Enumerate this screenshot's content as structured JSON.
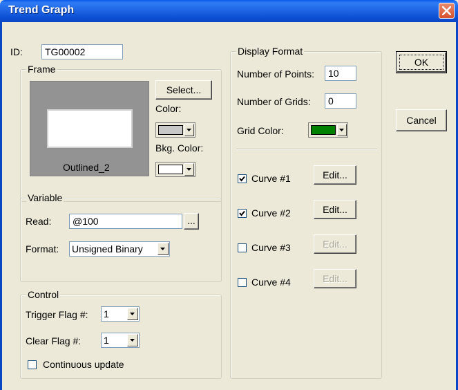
{
  "window": {
    "title": "Trend Graph",
    "close_label": "X"
  },
  "id_field": {
    "label": "ID:",
    "value": "TG00002"
  },
  "frame": {
    "legend": "Frame",
    "select_label": "Select...",
    "color_label": "Color:",
    "color": "#c8c8c8",
    "bkg_label": "Bkg. Color:",
    "bkg_color": "#ffffff",
    "preview_name": "Outlined_2"
  },
  "variable": {
    "legend": "Variable",
    "read_label": "Read:",
    "read_value": "@100",
    "browse_label": "...",
    "format_label": "Format:",
    "format_value": "Unsigned Binary"
  },
  "control": {
    "legend": "Control",
    "trigger_label": "Trigger Flag #:",
    "trigger_value": "1",
    "clear_label": "Clear Flag #:",
    "clear_value": "1",
    "continuous_label": "Continuous update",
    "continuous_checked": false
  },
  "display": {
    "legend": "Display Format",
    "points_label": "Number of Points:",
    "points_value": "10",
    "grids_label": "Number of Grids:",
    "grids_value": "0",
    "grid_color_label": "Grid Color:",
    "grid_color": "#008000",
    "curves": [
      {
        "label": "Curve #1",
        "checked": true,
        "edit_label": "Edit...",
        "enabled": true
      },
      {
        "label": "Curve #2",
        "checked": true,
        "edit_label": "Edit...",
        "enabled": true
      },
      {
        "label": "Curve #3",
        "checked": false,
        "edit_label": "Edit...",
        "enabled": false
      },
      {
        "label": "Curve #4",
        "checked": false,
        "edit_label": "Edit...",
        "enabled": false
      }
    ]
  },
  "buttons": {
    "ok": "OK",
    "cancel": "Cancel"
  },
  "icons": [
    "close-icon",
    "chevron-down-icon",
    "checkmark-icon"
  ]
}
